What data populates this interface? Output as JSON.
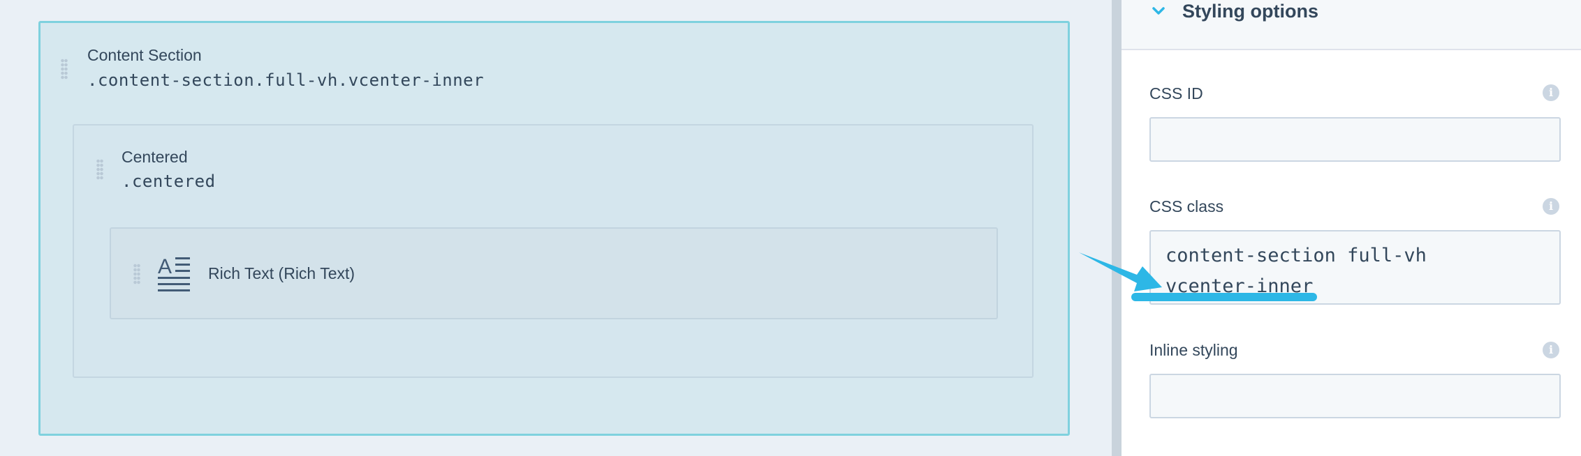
{
  "canvas": {
    "content_section": {
      "title": "Content Section",
      "class_name": ".content-section.full-vh.vcenter-inner"
    },
    "centered": {
      "title": "Centered",
      "class_name": ".centered"
    },
    "rich_text": {
      "label": "Rich Text (Rich Text)",
      "icon": "rich-text-icon"
    }
  },
  "panel": {
    "header": {
      "title": "Styling options",
      "icon": "chevron-down-icon"
    },
    "fields": {
      "css_id": {
        "label": "CSS ID",
        "value": "",
        "info_icon": "i"
      },
      "css_class": {
        "label": "CSS class",
        "value": "content-section full-vh\nvcenter-inner",
        "info_icon": "i"
      },
      "inline_styling": {
        "label": "Inline styling",
        "value": "",
        "info_icon": "i"
      }
    }
  },
  "colors": {
    "accent": "#2db7e6",
    "selection_border": "#7fd1de",
    "text": "#33475b"
  }
}
